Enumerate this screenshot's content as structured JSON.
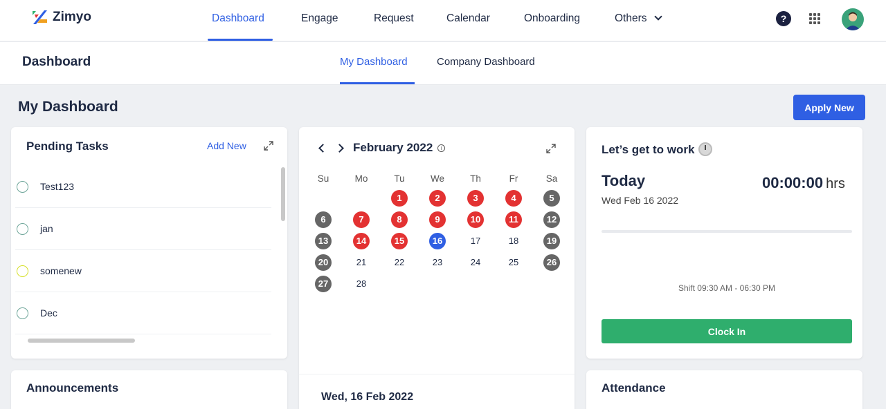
{
  "app": {
    "name": "Zimyo"
  },
  "nav": {
    "items": [
      "Dashboard",
      "Engage",
      "Request",
      "Calendar",
      "Onboarding",
      "Others"
    ],
    "help": "?"
  },
  "subbar": {
    "title": "Dashboard",
    "tabs": [
      "My Dashboard",
      "Company Dashboard"
    ]
  },
  "page": {
    "heading": "My Dashboard",
    "apply_label": "Apply New"
  },
  "tasks": {
    "title": "Pending Tasks",
    "add_label": "Add New",
    "items": [
      {
        "label": "Test123",
        "color": "#6fa69a"
      },
      {
        "label": "jan",
        "color": "#6fa69a"
      },
      {
        "label": "somenew",
        "color": "#d6e02a"
      },
      {
        "label": "Dec",
        "color": "#6fa69a"
      }
    ]
  },
  "calendar": {
    "month": "February 2022",
    "info": "i",
    "weekdays": [
      "Su",
      "Mo",
      "Tu",
      "We",
      "Th",
      "Fr",
      "Sa"
    ],
    "days": [
      {
        "d": "1",
        "s": "red"
      },
      {
        "d": "2",
        "s": "red"
      },
      {
        "d": "3",
        "s": "red"
      },
      {
        "d": "4",
        "s": "red"
      },
      {
        "d": "5",
        "s": "grey"
      },
      {
        "d": "6",
        "s": "grey"
      },
      {
        "d": "7",
        "s": "red"
      },
      {
        "d": "8",
        "s": "red"
      },
      {
        "d": "9",
        "s": "red"
      },
      {
        "d": "10",
        "s": "red"
      },
      {
        "d": "11",
        "s": "red"
      },
      {
        "d": "12",
        "s": "grey"
      },
      {
        "d": "13",
        "s": "grey"
      },
      {
        "d": "14",
        "s": "red"
      },
      {
        "d": "15",
        "s": "red"
      },
      {
        "d": "16",
        "s": "blue"
      },
      {
        "d": "17",
        "s": "plain"
      },
      {
        "d": "18",
        "s": "plain"
      },
      {
        "d": "19",
        "s": "grey"
      },
      {
        "d": "20",
        "s": "grey"
      },
      {
        "d": "21",
        "s": "plain"
      },
      {
        "d": "22",
        "s": "plain"
      },
      {
        "d": "23",
        "s": "plain"
      },
      {
        "d": "24",
        "s": "plain"
      },
      {
        "d": "25",
        "s": "plain"
      },
      {
        "d": "26",
        "s": "grey"
      },
      {
        "d": "27",
        "s": "grey"
      },
      {
        "d": "28",
        "s": "plain"
      }
    ],
    "selected_date": "Wed, 16 Feb 2022"
  },
  "work": {
    "title": "Let’s get to work",
    "today": "Today",
    "date": "Wed Feb 16 2022",
    "timer": "00:00:00",
    "unit": "hrs",
    "shift": "Shift 09:30 AM - 06:30 PM",
    "clock_in": "Clock In"
  },
  "announcements": {
    "title": "Announcements"
  },
  "attendance": {
    "title": "Attendance"
  },
  "colors": {
    "accent": "#2f5fe3",
    "holiday": "#e33232",
    "weekend": "#666666",
    "success": "#2fae6d"
  }
}
